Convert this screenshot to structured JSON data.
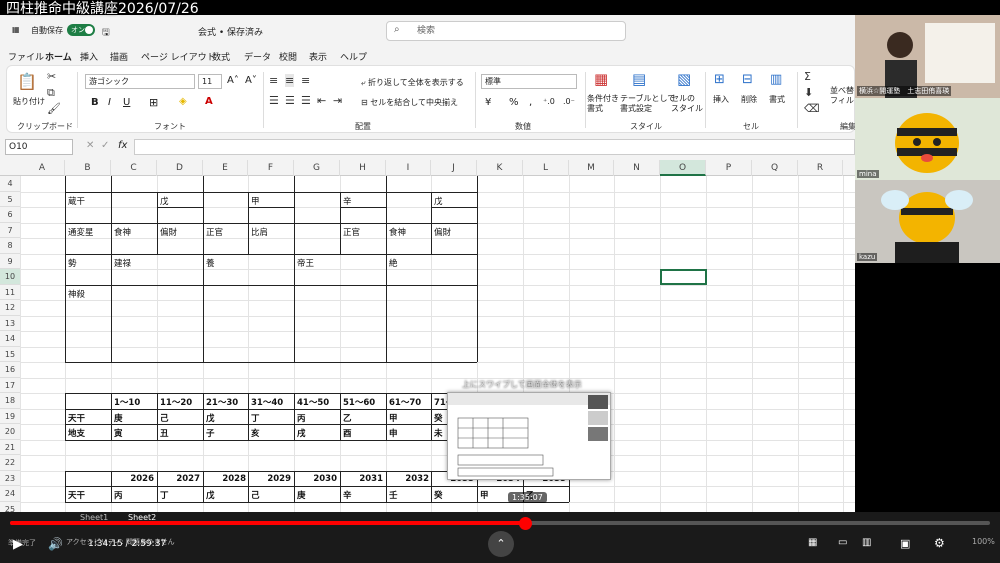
{
  "title_overlay": "四柱推命中級講座2026/07/26",
  "titlebar": {
    "autosave_label": "自動保存",
    "autosave_state": "オン",
    "doc_name": "会式 • 保存済み",
    "search_placeholder": "検索"
  },
  "menu": {
    "tabs": [
      "ファイル",
      "ホーム",
      "挿入",
      "描画",
      "ページ レイアウト",
      "数式",
      "データ",
      "校閲",
      "表示",
      "ヘルプ"
    ]
  },
  "ribbon": {
    "paste_label": "貼り付け",
    "clipboard_group": "クリップボード",
    "font_name": "游ゴシック",
    "font_size": "11",
    "font_group": "フォント",
    "wrap_text": "折り返して全体を表示する",
    "merge_center": "セルを結合して中央揃え",
    "alignment_group": "配置",
    "number_format": "標準",
    "number_group": "数値",
    "cond_format": "条件付き\n書式",
    "table_format": "テーブルとして\n書式設定",
    "cell_style": "セルの\nスタイル",
    "style_group": "スタイル",
    "insert": "挿入",
    "delete": "削除",
    "format": "書式",
    "cells_group": "セル",
    "sort_filter": "並べ替\nフィル",
    "edit_group": "編集"
  },
  "formula_bar": {
    "name_box": "O10",
    "fx": "fx"
  },
  "columns": [
    "A",
    "B",
    "C",
    "D",
    "E",
    "F",
    "G",
    "H",
    "I",
    "J",
    "K",
    "L",
    "M",
    "N",
    "O",
    "P",
    "Q",
    "R"
  ],
  "rows": [
    "4",
    "5",
    "6",
    "7",
    "8",
    "9",
    "10",
    "11",
    "12",
    "13",
    "14",
    "15",
    "16",
    "17",
    "18",
    "19",
    "20",
    "21",
    "22",
    "23",
    "24",
    "25"
  ],
  "cells": {
    "r5b": "蔵干",
    "r5d": "戊",
    "r5f": "甲",
    "r5h": "辛",
    "r5j": "戊",
    "r7b": "通変星",
    "r7c": "食神",
    "r7d": "偏財",
    "r7e": "正官",
    "r7f": "比肩",
    "r7h": "正官",
    "r7i": "食神",
    "r7j": "偏財",
    "r9b": "勢",
    "r9c": "建禄",
    "r9e": "養",
    "r9g": "帝王",
    "r9i": "絶",
    "r11b": "神殺",
    "r18": [
      "1～10",
      "11～20",
      "21～30",
      "31～40",
      "41～50",
      "51～60",
      "61～70",
      "71～"
    ],
    "r19_label": "天干",
    "r19": [
      "庚",
      "己",
      "戊",
      "丁",
      "丙",
      "乙",
      "甲",
      "癸"
    ],
    "r20_label": "地支",
    "r20": [
      "寅",
      "丑",
      "子",
      "亥",
      "戌",
      "酉",
      "申",
      "未"
    ],
    "r23": [
      "2026",
      "2027",
      "2028",
      "2029",
      "2030",
      "2031",
      "2032",
      "2033",
      "2034",
      "2035"
    ],
    "r24_label": "天干",
    "r24": [
      "丙",
      "丁",
      "戊",
      "己",
      "庚",
      "辛",
      "壬",
      "癸",
      "甲",
      "乙"
    ]
  },
  "sheets": [
    "Sheet1",
    "Sheet2"
  ],
  "video": {
    "time": "1:34:15 / 2:59:37",
    "preview_time": "1:35:07",
    "preview_label": "上にスワイプして画面全体を表示",
    "status_left": "準備完了",
    "accessibility": "アクセシビリティ: 問題ありません",
    "zoom": "100%",
    "progress": 0.526
  },
  "participants": [
    {
      "name": "横浜☆開運塾　土志田侑喜瑛"
    },
    {
      "name": "mina"
    },
    {
      "name": "kazu"
    }
  ]
}
